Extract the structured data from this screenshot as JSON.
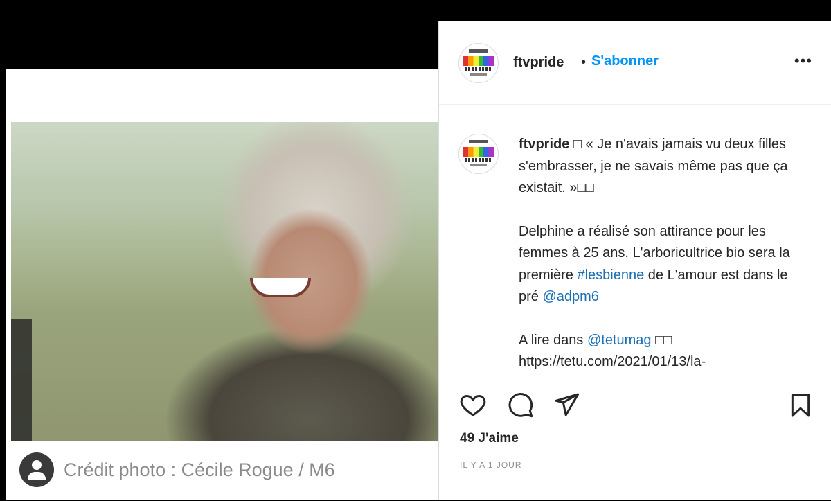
{
  "left": {
    "credit": "Crédit photo : Cécile Rogue / M6"
  },
  "post": {
    "username": "ftvpride",
    "dot": "•",
    "follow_label": "S'abonner",
    "more": "•••",
    "caption": {
      "username": "ftvpride",
      "line1": " □ « Je n'avais jamais vu deux filles s'embrasser, je ne savais même pas que ça existait. »□□",
      "p2_a": "Delphine a réalisé son attirance pour les femmes à 25 ans. L'arboricultrice bio sera la première ",
      "hashtag": "#lesbienne",
      "p2_b": " de L'amour est dans le pré ",
      "mention1": "@adpm6",
      "p3_a": "A lire dans ",
      "mention2": "@tetumag",
      "p3_b": " □□",
      "url": "https://tetu.com/2021/01/13/la-"
    },
    "likes": "49 J'aime",
    "time": "IL Y A 1 JOUR"
  },
  "icons": {
    "like": "heart-icon",
    "comment": "comment-icon",
    "share": "paper-plane-icon",
    "save": "bookmark-icon"
  }
}
